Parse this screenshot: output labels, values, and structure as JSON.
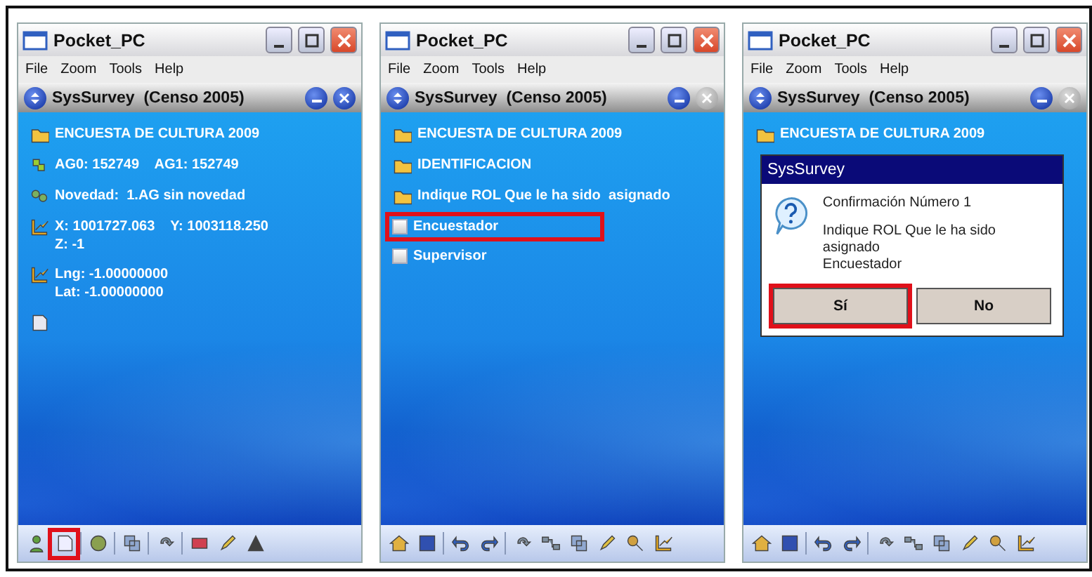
{
  "screens": [
    {
      "window_title": "Pocket_PC",
      "menu": [
        "File",
        "Zoom",
        "Tools",
        "Help"
      ],
      "app_title": "SysSurvey  (Censo 2005)",
      "close_enabled": true,
      "items": [
        {
          "kind": "folder",
          "lines": [
            "ENCUESTA DE CULTURA 2009"
          ],
          "highlighted": false
        },
        {
          "kind": "puzzle",
          "lines": [
            "AG0: 152749    AG1: 152749"
          ],
          "highlighted": false
        },
        {
          "kind": "people",
          "lines": [
            "Novedad:  1.AG sin novedad"
          ],
          "highlighted": false
        },
        {
          "kind": "chart",
          "lines": [
            "X: 1001727.063    Y: 1003118.250",
            "Z: -1"
          ],
          "highlighted": false
        },
        {
          "kind": "chart",
          "lines": [
            "Lng: -1.00000000",
            "Lat: -1.00000000"
          ],
          "highlighted": false
        },
        {
          "kind": "note",
          "highlighted": false
        }
      ],
      "toolbar": [
        {
          "kind": "person",
          "highlighted": false
        },
        {
          "kind": "edit",
          "highlighted": true
        },
        {
          "kind": "sep"
        },
        {
          "kind": "globe",
          "highlighted": false
        },
        {
          "kind": "sep"
        },
        {
          "kind": "copy",
          "highlighted": false
        },
        {
          "kind": "sep"
        },
        {
          "kind": "sync",
          "highlighted": false
        },
        {
          "kind": "sep"
        },
        {
          "kind": "flag",
          "highlighted": false
        },
        {
          "kind": "pen",
          "highlighted": false
        },
        {
          "kind": "level",
          "highlighted": false
        }
      ]
    },
    {
      "window_title": "Pocket_PC",
      "menu": [
        "File",
        "Zoom",
        "Tools",
        "Help"
      ],
      "app_title": "SysSurvey  (Censo 2005)",
      "close_enabled": false,
      "items": [
        {
          "kind": "folder",
          "lines": [
            "ENCUESTA DE CULTURA 2009"
          ],
          "highlighted": false
        },
        {
          "kind": "folder",
          "lines": [
            "IDENTIFICACION"
          ],
          "highlighted": false
        },
        {
          "kind": "folder-check",
          "lines": [
            "Indique ROL Que le ha sido  asignado"
          ],
          "highlighted": false
        },
        {
          "kind": "checkbox",
          "lines": [
            "Encuestador"
          ],
          "checked": false,
          "highlighted": true
        },
        {
          "kind": "checkbox",
          "lines": [
            "Supervisor"
          ],
          "checked": false,
          "highlighted": false
        }
      ],
      "toolbar": [
        {
          "kind": "home",
          "highlighted": false
        },
        {
          "kind": "save",
          "highlighted": false
        },
        {
          "kind": "sep"
        },
        {
          "kind": "undo",
          "highlighted": false
        },
        {
          "kind": "redo",
          "highlighted": false
        },
        {
          "kind": "sep"
        },
        {
          "kind": "sync",
          "highlighted": false
        },
        {
          "kind": "network",
          "highlighted": false
        },
        {
          "kind": "copy",
          "highlighted": false
        },
        {
          "kind": "pen",
          "highlighted": false
        },
        {
          "kind": "search",
          "highlighted": false
        },
        {
          "kind": "chart",
          "highlighted": false
        }
      ]
    },
    {
      "window_title": "Pocket_PC",
      "menu": [
        "File",
        "Zoom",
        "Tools",
        "Help"
      ],
      "app_title": "SysSurvey  (Censo 2005)",
      "close_enabled": false,
      "items": [
        {
          "kind": "folder",
          "lines": [
            "ENCUESTA DE CULTURA 2009"
          ],
          "highlighted": false
        }
      ],
      "dialog": {
        "title": "SysSurvey",
        "heading": "Confirmación Número 1",
        "message": "Indique ROL Que le ha sido asignado",
        "value": "Encuestador",
        "buttons": [
          {
            "label": "Sí",
            "highlighted": true
          },
          {
            "label": "No",
            "highlighted": false
          }
        ]
      },
      "toolbar": [
        {
          "kind": "home",
          "highlighted": false
        },
        {
          "kind": "save",
          "highlighted": false
        },
        {
          "kind": "sep"
        },
        {
          "kind": "undo",
          "highlighted": false
        },
        {
          "kind": "redo",
          "highlighted": false
        },
        {
          "kind": "sep"
        },
        {
          "kind": "sync",
          "highlighted": false
        },
        {
          "kind": "network",
          "highlighted": false
        },
        {
          "kind": "copy",
          "highlighted": false
        },
        {
          "kind": "pen",
          "highlighted": false
        },
        {
          "kind": "search",
          "highlighted": false
        },
        {
          "kind": "chart",
          "highlighted": false
        }
      ]
    }
  ]
}
